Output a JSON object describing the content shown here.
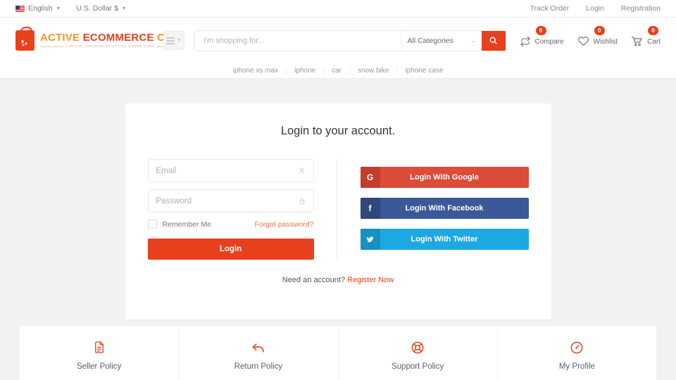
{
  "topbar": {
    "language": "English",
    "currency": "U.S. Dollar $",
    "links": [
      {
        "label": "Track Order"
      },
      {
        "label": "Login"
      },
      {
        "label": "Registration"
      }
    ]
  },
  "header": {
    "logo": {
      "word1": "ACTIVE",
      "word2": "ECOMMERCE",
      "word3": "CMS",
      "tagline": "LARAVEL VERSION OF ACTIVE SUPER SHOP"
    },
    "search": {
      "placeholder": "I'm shopping for...",
      "value": "",
      "category": "All Categories"
    },
    "icons": [
      {
        "name": "compare",
        "label": "Compare",
        "count": "0"
      },
      {
        "name": "wishlist",
        "label": "Wishlist",
        "count": "0"
      },
      {
        "name": "cart",
        "label": "Cart",
        "count": "0"
      }
    ]
  },
  "tags": [
    {
      "label": "iphone xs max"
    },
    {
      "label": "iphone"
    },
    {
      "label": "car"
    },
    {
      "label": "snow bike"
    },
    {
      "label": "iphone case"
    }
  ],
  "login": {
    "title": "Login to your account.",
    "email": {
      "placeholder": "Email",
      "value": ""
    },
    "password": {
      "placeholder": "Password",
      "value": ""
    },
    "remember_label": "Remember Me",
    "forgot_label": "Forgot password?",
    "submit_label": "Login",
    "social": [
      {
        "name": "google",
        "label": "Login With Google",
        "glyph": "G",
        "bg": "#dd4b39",
        "icon_bg": "#c33d2c"
      },
      {
        "name": "facebook",
        "label": "Login With Facebook",
        "glyph": "f",
        "bg": "#3b5998",
        "icon_bg": "#2f4779"
      },
      {
        "name": "twitter",
        "label": "Login With Twitter",
        "glyph": "t",
        "bg": "#1da8e2",
        "icon_bg": "#1790c3"
      }
    ],
    "need_account": "Need an account?",
    "register_label": "Register Now"
  },
  "footer": {
    "cards": [
      {
        "icon": "document-icon",
        "label": "Seller Policy"
      },
      {
        "icon": "return-arrow-icon",
        "label": "Return Policy"
      },
      {
        "icon": "lifebuoy-icon",
        "label": "Support Policy"
      },
      {
        "icon": "speedometer-icon",
        "label": "My Profile"
      }
    ]
  },
  "colors": {
    "brand": "#e8401c",
    "brand_orange": "#f0962a",
    "page_bg": "#f2f2f2"
  }
}
